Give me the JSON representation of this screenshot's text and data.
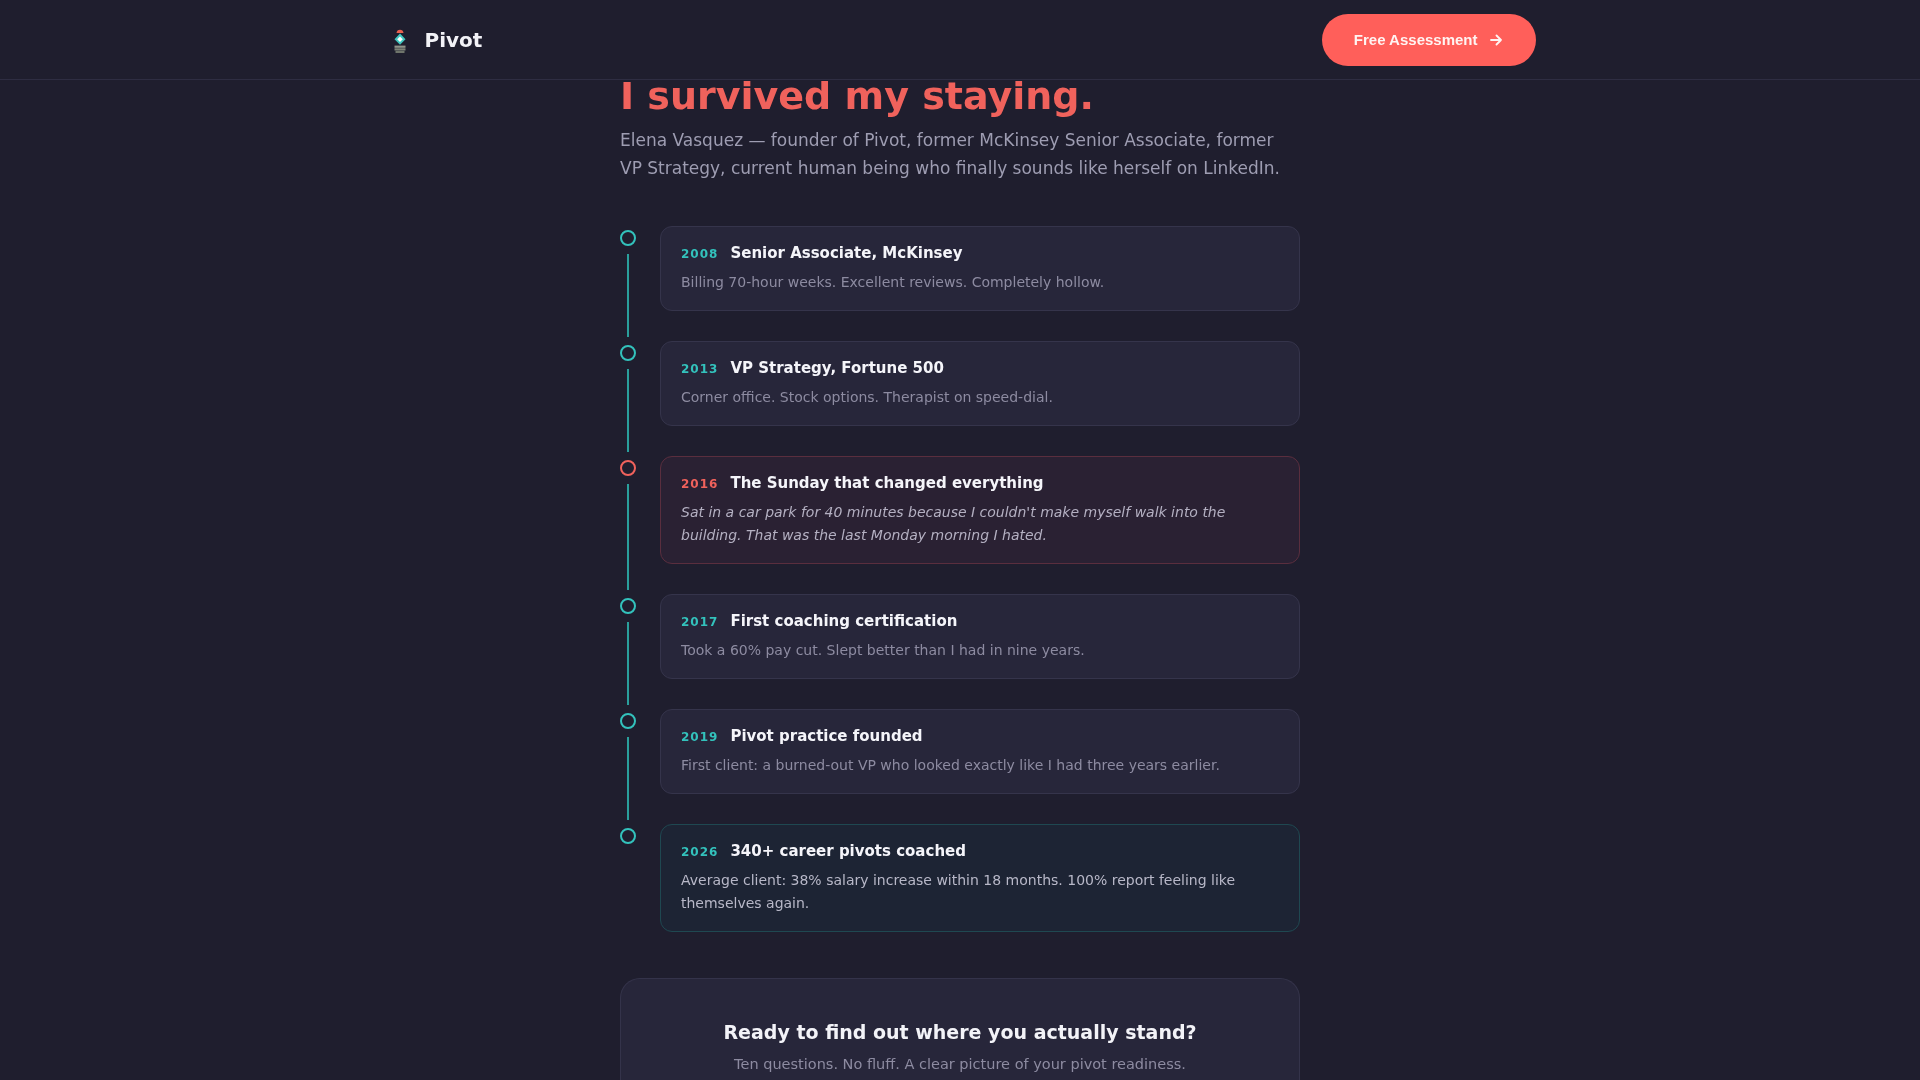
{
  "header": {
    "brand": "Pivot",
    "cta_button": {
      "label": "Free Assessment"
    }
  },
  "hero": {
    "title": "I survived my staying.",
    "subtitle": "Elena Vasquez — founder of Pivot, former McKinsey Senior Associate, former VP Strategy, current human being who finally sounds like herself on LinkedIn."
  },
  "timeline": [
    {
      "kind": "standard",
      "year": "2008",
      "title": "Senior Associate, McKinsey",
      "description": "Billing 70-hour weeks. Excellent reviews. Completely hollow."
    },
    {
      "kind": "standard",
      "year": "2013",
      "title": "VP Strategy, Fortune 500",
      "description": "Corner office. Stock options. Therapist on speed-dial."
    },
    {
      "kind": "turning-point",
      "year": "2016",
      "title": "The Sunday that changed everything",
      "description": "Sat in a car park for 40 minutes because I couldn't make myself walk into the building. That was the last Monday morning I hated."
    },
    {
      "kind": "standard",
      "year": "2017",
      "title": "First coaching certification",
      "description": "Took a 60% pay cut. Slept better than I had in nine years."
    },
    {
      "kind": "standard",
      "year": "2019",
      "title": "Pivot practice founded",
      "description": "First client: a burned-out VP who looked exactly like I had three years earlier."
    },
    {
      "kind": "highlight",
      "year": "2026",
      "title": "340+ career pivots coached",
      "description": "Average client: 38% salary increase within 18 months. 100% report feeling like themselves again."
    }
  ],
  "cta": {
    "title": "Ready to find out where you actually stand?",
    "text": "Ten questions. No fluff. A clear picture of your pivot readiness."
  }
}
